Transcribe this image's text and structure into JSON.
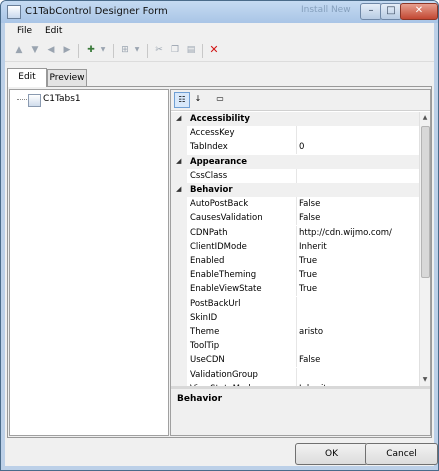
{
  "window": {
    "title": "C1TabControl Designer Form",
    "background_text": "Install New"
  },
  "menu": [
    "File",
    "Edit"
  ],
  "tabs": [
    {
      "label": "Edit"
    },
    {
      "label": "Preview"
    }
  ],
  "tree": {
    "items": [
      {
        "label": "C1Tabs1"
      }
    ]
  },
  "properties": {
    "rows": [
      {
        "type": "category",
        "name": "Accessibility"
      },
      {
        "type": "prop",
        "name": "AccessKey",
        "value": ""
      },
      {
        "type": "prop",
        "name": "TabIndex",
        "value": "0"
      },
      {
        "type": "category",
        "name": "Appearance"
      },
      {
        "type": "prop",
        "name": "CssClass",
        "value": ""
      },
      {
        "type": "category",
        "name": "Behavior"
      },
      {
        "type": "prop",
        "name": "AutoPostBack",
        "value": "False"
      },
      {
        "type": "prop",
        "name": "CausesValidation",
        "value": "False"
      },
      {
        "type": "prop",
        "name": "CDNPath",
        "value": "http://cdn.wijmo.com/"
      },
      {
        "type": "prop",
        "name": "ClientIDMode",
        "value": "Inherit"
      },
      {
        "type": "prop",
        "name": "Enabled",
        "value": "True"
      },
      {
        "type": "prop",
        "name": "EnableTheming",
        "value": "True"
      },
      {
        "type": "prop",
        "name": "EnableViewState",
        "value": "True"
      },
      {
        "type": "prop",
        "name": "PostBackUrl",
        "value": ""
      },
      {
        "type": "prop",
        "name": "SkinID",
        "value": ""
      },
      {
        "type": "prop",
        "name": "Theme",
        "value": "aristo"
      },
      {
        "type": "prop",
        "name": "ToolTip",
        "value": ""
      },
      {
        "type": "prop",
        "name": "UseCDN",
        "value": "False"
      },
      {
        "type": "prop",
        "name": "ValidationGroup",
        "value": ""
      },
      {
        "type": "prop",
        "name": "ViewStateMode",
        "value": "Inherit"
      }
    ],
    "description_title": "Behavior"
  },
  "buttons": {
    "ok": "OK",
    "cancel": "Cancel"
  }
}
